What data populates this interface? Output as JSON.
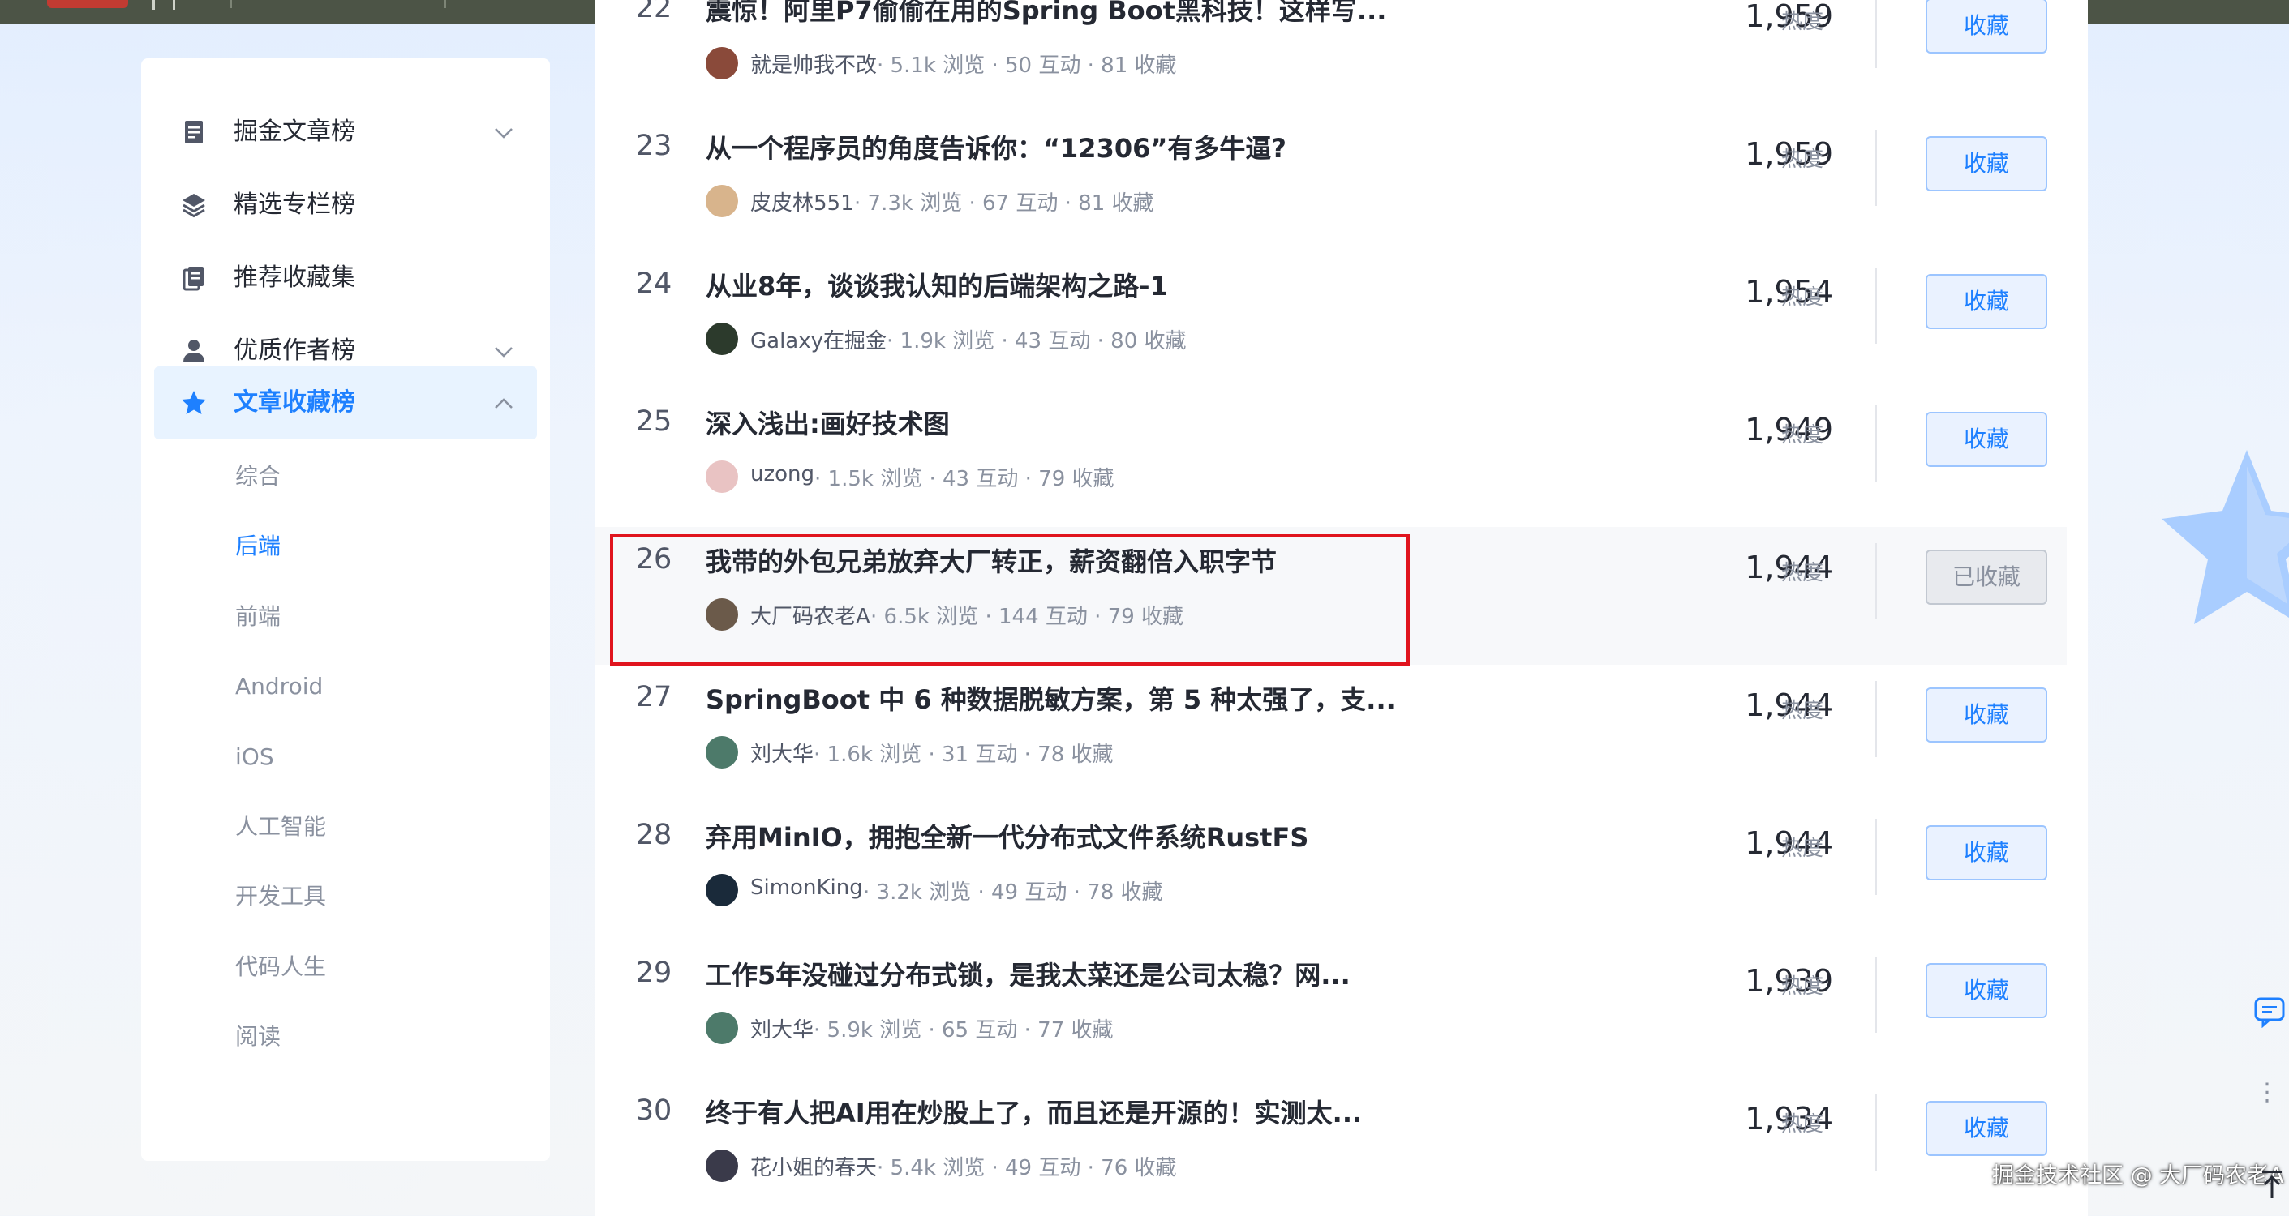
{
  "sidebar": {
    "items": [
      {
        "label": "掘金文章榜",
        "icon": "document-icon",
        "chevron": "down"
      },
      {
        "label": "精选专栏榜",
        "icon": "layers-icon",
        "chevron": ""
      },
      {
        "label": "推荐收藏集",
        "icon": "collection-icon",
        "chevron": ""
      },
      {
        "label": "优质作者榜",
        "icon": "user-icon",
        "chevron": "down"
      },
      {
        "label": "文章收藏榜",
        "icon": "star-icon",
        "chevron": "up",
        "active": true
      }
    ],
    "sub_items": [
      "综合",
      "后端",
      "前端",
      "Android",
      "iOS",
      "人工智能",
      "开发工具",
      "代码人生",
      "阅读"
    ],
    "active_sub": "后端"
  },
  "articles": [
    {
      "rank": "22",
      "title": "震惊！阿里P7偷偷在用的Spring Boot黑科技！这样写...",
      "author": "就是帅我不改",
      "views": "5.1k 浏览",
      "interactions": "50 互动",
      "collects": "81 收藏",
      "heat": "1,959",
      "heat_unit": "热度",
      "button": "收藏"
    },
    {
      "rank": "23",
      "title": "从一个程序员的角度告诉你：“12306”有多牛逼?",
      "author": "皮皮林551",
      "views": "7.3k 浏览",
      "interactions": "67 互动",
      "collects": "81 收藏",
      "heat": "1,959",
      "heat_unit": "热度",
      "button": "收藏"
    },
    {
      "rank": "24",
      "title": "从业8年，谈谈我认知的后端架构之路-1",
      "author": "Galaxy在掘金",
      "views": "1.9k 浏览",
      "interactions": "43 互动",
      "collects": "80 收藏",
      "heat": "1,954",
      "heat_unit": "热度",
      "button": "收藏"
    },
    {
      "rank": "25",
      "title": "深入浅出:画好技术图",
      "author": "uzong",
      "views": "1.5k 浏览",
      "interactions": "43 互动",
      "collects": "79 收藏",
      "heat": "1,949",
      "heat_unit": "热度",
      "button": "收藏"
    },
    {
      "rank": "26",
      "title": "我带的外包兄弟放弃大厂转正，薪资翻倍入职字节",
      "author": "大厂码农老A",
      "views": "6.5k 浏览",
      "interactions": "144 互动",
      "collects": "79 收藏",
      "heat": "1,944",
      "heat_unit": "热度",
      "button": "已收藏",
      "collected": true
    },
    {
      "rank": "27",
      "title": "SpringBoot 中 6 种数据脱敏方案，第 5 种太强了，支...",
      "author": "刘大华",
      "views": "1.6k 浏览",
      "interactions": "31 互动",
      "collects": "78 收藏",
      "heat": "1,944",
      "heat_unit": "热度",
      "button": "收藏"
    },
    {
      "rank": "28",
      "title": "弃用MinIO，拥抱全新一代分布式文件系统RustFS",
      "author": "SimonKing",
      "views": "3.2k 浏览",
      "interactions": "49 互动",
      "collects": "78 收藏",
      "heat": "1,944",
      "heat_unit": "热度",
      "button": "收藏"
    },
    {
      "rank": "29",
      "title": "工作5年没碰过分布式锁，是我太菜还是公司太稳？网...",
      "author": "刘大华",
      "views": "5.9k 浏览",
      "interactions": "65 互动",
      "collects": "77 收藏",
      "heat": "1,939",
      "heat_unit": "热度",
      "button": "收藏"
    },
    {
      "rank": "30",
      "title": "终于有人把AI用在炒股上了，而且还是开源的！实测太...",
      "author": "花小姐的春天",
      "views": "5.4k 浏览",
      "interactions": "49 互动",
      "collects": "76 收藏",
      "heat": "1,934",
      "heat_unit": "热度",
      "button": "收藏"
    }
  ],
  "watermark": "掘金技术社区 @ 大厂码农老A",
  "colors": {
    "accent": "#1e80ff",
    "highlight": "#e0141e",
    "muted": "#8a919f"
  }
}
